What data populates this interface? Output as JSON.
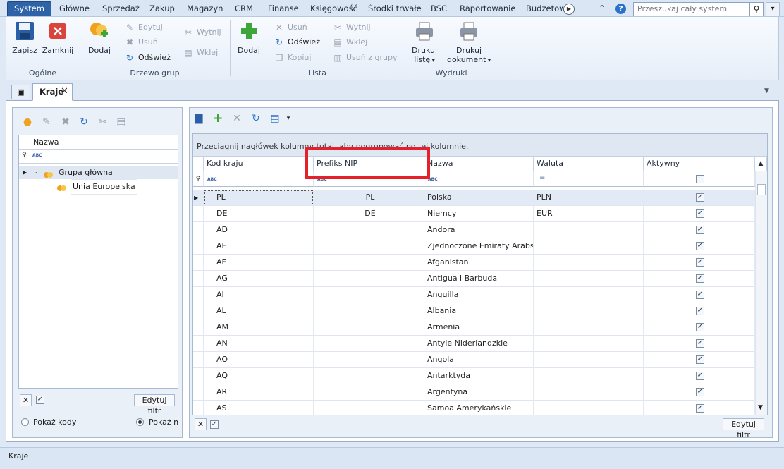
{
  "menu": {
    "items": [
      "System",
      "Główne",
      "Sprzedaż",
      "Zakup",
      "Magazyn",
      "CRM",
      "Finanse",
      "Księgowość",
      "Środki trwałe",
      "BSC",
      "Raportowanie",
      "Budżetow"
    ],
    "search_placeholder": "Przeszukaj cały system"
  },
  "ribbon": {
    "ogolne": {
      "label": "Ogólne",
      "save": "Zapisz",
      "close": "Zamknij"
    },
    "drzewo": {
      "label": "Drzewo grup",
      "add": "Dodaj",
      "edit": "Edytuj",
      "delete": "Usuń",
      "refresh": "Odśwież",
      "cut": "Wytnij",
      "paste": "Wklej"
    },
    "lista": {
      "label": "Lista",
      "add": "Dodaj",
      "delete": "Usuń",
      "refresh": "Odśwież",
      "copy": "Kopiuj",
      "cut": "Wytnij",
      "paste": "Wklej",
      "delete_group": "Usuń z grupy"
    },
    "wydruki": {
      "label": "Wydruki",
      "print_list_1": "Drukuj",
      "print_list_2": "listę",
      "print_doc_1": "Drukuj",
      "print_doc_2": "dokument"
    }
  },
  "tab": {
    "label": "Kraje"
  },
  "tree": {
    "header": "Nazwa",
    "items": [
      {
        "label": "Grupa główna"
      },
      {
        "label": "Unia Europejska"
      }
    ],
    "edit_filter": "Edytuj filtr",
    "show_codes": "Pokaż kody",
    "show_names": "Pokaż na"
  },
  "grid": {
    "group_hint": "Przeciągnij nagłówek kolumny tutaj, aby pogrupować po tej kolumnie.",
    "columns": [
      "Kod kraju",
      "Prefiks NIP",
      "Nazwa",
      "Waluta",
      "Aktywny"
    ],
    "rows": [
      {
        "code": "PL",
        "prefix": "PL",
        "name": "Polska",
        "currency": "PLN",
        "active": true
      },
      {
        "code": "DE",
        "prefix": "DE",
        "name": "Niemcy",
        "currency": "EUR",
        "active": true
      },
      {
        "code": "AD",
        "prefix": "",
        "name": "Andora",
        "currency": "",
        "active": true
      },
      {
        "code": "AE",
        "prefix": "",
        "name": "Zjednoczone Emiraty Arabs...",
        "currency": "",
        "active": true
      },
      {
        "code": "AF",
        "prefix": "",
        "name": "Afganistan",
        "currency": "",
        "active": true
      },
      {
        "code": "AG",
        "prefix": "",
        "name": "Antigua i Barbuda",
        "currency": "",
        "active": true
      },
      {
        "code": "AI",
        "prefix": "",
        "name": "Anguilla",
        "currency": "",
        "active": true
      },
      {
        "code": "AL",
        "prefix": "",
        "name": "Albania",
        "currency": "",
        "active": true
      },
      {
        "code": "AM",
        "prefix": "",
        "name": "Armenia",
        "currency": "",
        "active": true
      },
      {
        "code": "AN",
        "prefix": "",
        "name": "Antyle Niderlandzkie",
        "currency": "",
        "active": true
      },
      {
        "code": "AO",
        "prefix": "",
        "name": "Angola",
        "currency": "",
        "active": true
      },
      {
        "code": "AQ",
        "prefix": "",
        "name": "Antarktyda",
        "currency": "",
        "active": true
      },
      {
        "code": "AR",
        "prefix": "",
        "name": "Argentyna",
        "currency": "",
        "active": true
      },
      {
        "code": "AS",
        "prefix": "",
        "name": "Samoa Amerykańskie",
        "currency": "",
        "active": true
      }
    ],
    "edit_filter": "Edytuj filtr"
  },
  "status": {
    "text": "Kraje"
  }
}
